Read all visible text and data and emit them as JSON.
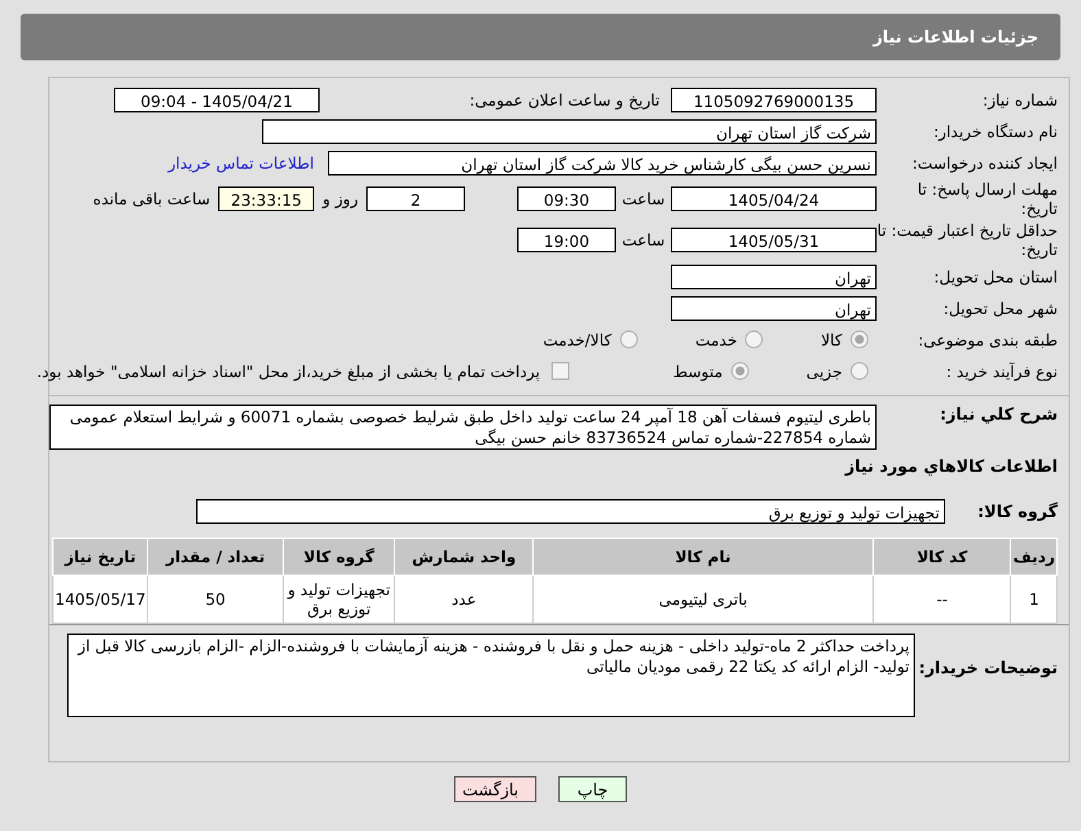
{
  "header": {
    "title": "جزئیات اطلاعات نیاز"
  },
  "need_number": {
    "label": "شماره نیاز:",
    "value": "1105092769000135"
  },
  "announce": {
    "label": "تاریخ و ساعت اعلان عمومی:",
    "value": "1405/04/21 - 09:04"
  },
  "buyer_org": {
    "label": "نام دستگاه خریدار:",
    "value": "شرکت گاز استان تهران"
  },
  "creator": {
    "label": "ایجاد کننده درخواست:",
    "value": "نسرین حسن بیگی کارشناس خرید کالا شرکت گاز استان تهران",
    "link": "اطلاعات تماس خریدار"
  },
  "deadline": {
    "label": "مهلت ارسال پاسخ: تا تاریخ:",
    "date": "1405/04/24",
    "time_label": "ساعت",
    "time": "09:30",
    "days": "2",
    "days_label": "روز و",
    "remaining": "23:33:15",
    "remaining_label": "ساعت باقی مانده"
  },
  "validity": {
    "label": "حداقل تاریخ اعتبار قیمت: تا تاریخ:",
    "date": "1405/05/31",
    "time_label": "ساعت",
    "time": "19:00"
  },
  "province": {
    "label": "استان محل تحویل:",
    "value": "تهران"
  },
  "city": {
    "label": "شهر محل تحویل:",
    "value": "تهران"
  },
  "category": {
    "label": "طبقه بندی موضوعی:",
    "options": [
      {
        "label": "کالا",
        "selected": true
      },
      {
        "label": "خدمت",
        "selected": false
      },
      {
        "label": "کالا/خدمت",
        "selected": false
      }
    ]
  },
  "process": {
    "label": "نوع فرآیند خرید :",
    "options": [
      {
        "label": "جزیی",
        "selected": false
      },
      {
        "label": "متوسط",
        "selected": true
      }
    ],
    "treasury": {
      "checked": false,
      "label": "پرداخت تمام یا بخشی از مبلغ خرید،از محل \"اسناد خزانه اسلامی\" خواهد بود."
    }
  },
  "description": {
    "label": "شرح کلي نياز:",
    "value": "باطری لیتیوم فسفات آهن 18 آمپر 24 ساعت تولید داخل طبق شرلیط خصوصی بشماره 60071 و شرایط استعلام عمومی شماره 227854-شماره تماس 83736524 خانم حسن بیگی"
  },
  "goods_heading": "اطلاعات کالاهاي مورد نياز",
  "goods_group": {
    "label": "گروه کالا:",
    "value": "تجهیزات تولید و توزیع برق"
  },
  "table": {
    "columns": [
      "ردیف",
      "کد کالا",
      "نام کالا",
      "واحد شمارش",
      "گروه کالا",
      "تعداد / مقدار",
      "تاریخ نیاز"
    ],
    "rows": [
      [
        "1",
        "--",
        "باتری لیتیومی",
        "عدد",
        "تجهیزات تولید و توزیع برق",
        "50",
        "1405/05/17"
      ]
    ]
  },
  "buyer_notes": {
    "label": "توضیحات خریدار:",
    "value": "پرداخت حداکثر 2 ماه-تولید داخلی - هزینه حمل و نقل با فروشنده - هزینه آزمایشات با فروشنده-الزام  -الزام بازرسی کالا قبل از تولید- الزام ارائه کد یکتا 22 رقمی مودیان مالیاتی"
  },
  "buttons": [
    {
      "label": "چاپ",
      "kind": "print"
    },
    {
      "label": "بازگشت",
      "kind": "back"
    }
  ]
}
